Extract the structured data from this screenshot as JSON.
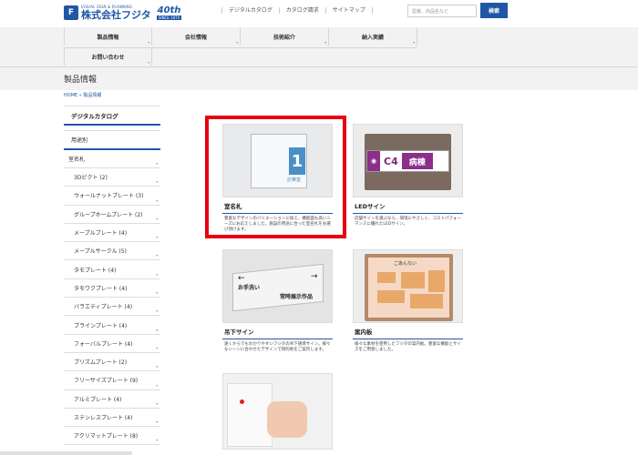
{
  "header": {
    "logo_tagline": "VISUAL SIGN & PLANNING",
    "logo_company": "株式会社フジタ",
    "anniversary": "40th",
    "anniversary_since": "SINCE 1975",
    "links": [
      "デジタルカタログ",
      "カタログ請求",
      "サイトマップ"
    ],
    "search_placeholder": "型番、商品名など",
    "search_button": "検索"
  },
  "global_nav": [
    "製品情報",
    "会社情報",
    "技術紹介",
    "納入実績",
    "お問い合わせ"
  ],
  "page": {
    "title": "製品情報",
    "breadcrumb": [
      "HOME",
      "製品情報"
    ]
  },
  "sidebar": {
    "heading": "デジタルカタログ",
    "subheading": "用途別",
    "category": "室名札",
    "items": [
      "3Dピクト (2)",
      "ウォールナットプレート (3)",
      "グループホームプレート (2)",
      "メープルプレート (4)",
      "メープルサークル (5)",
      "タモプレート (4)",
      "タモワクプレート (4)",
      "バラエティプレート (4)",
      "ブラインプレート (4)",
      "フォーバルプレート (4)",
      "プリズムプレート (2)",
      "フリーサイズプレート (9)",
      "アルミプレート (4)",
      "ステンレスプレート (4)",
      "アクリマットプレート (8)"
    ]
  },
  "products": [
    {
      "title": "室名札",
      "desc": "豊富なデザインのバリエーションに加え、機能面も高いニーズにお応えしました。施設の用途に合った室名札をお選び頂けます。",
      "img_text": "1",
      "img_sub": "診察室"
    },
    {
      "title": "LEDサイン",
      "desc": "店舗サインを選ぶなら、環境にやさしく、コストパフォーマンスに優れたLEDサイン。",
      "img_text": "C4",
      "img_sub": "病棟"
    },
    {
      "title": "吊下サイン",
      "desc": "遠くからでもわかりやすいフジタの吊下誘導サイン。様々なシーンに合わせたデザインで目的地をご案内します。",
      "img_text": "お手洗い",
      "img_sub": "常時展示作品"
    },
    {
      "title": "案内板",
      "desc": "様々な素材を使用したフジタの案内板。豊富な機能とサイズをご用意しました。",
      "img_text": "ごあんない"
    },
    {
      "title": "",
      "desc": ""
    }
  ]
}
